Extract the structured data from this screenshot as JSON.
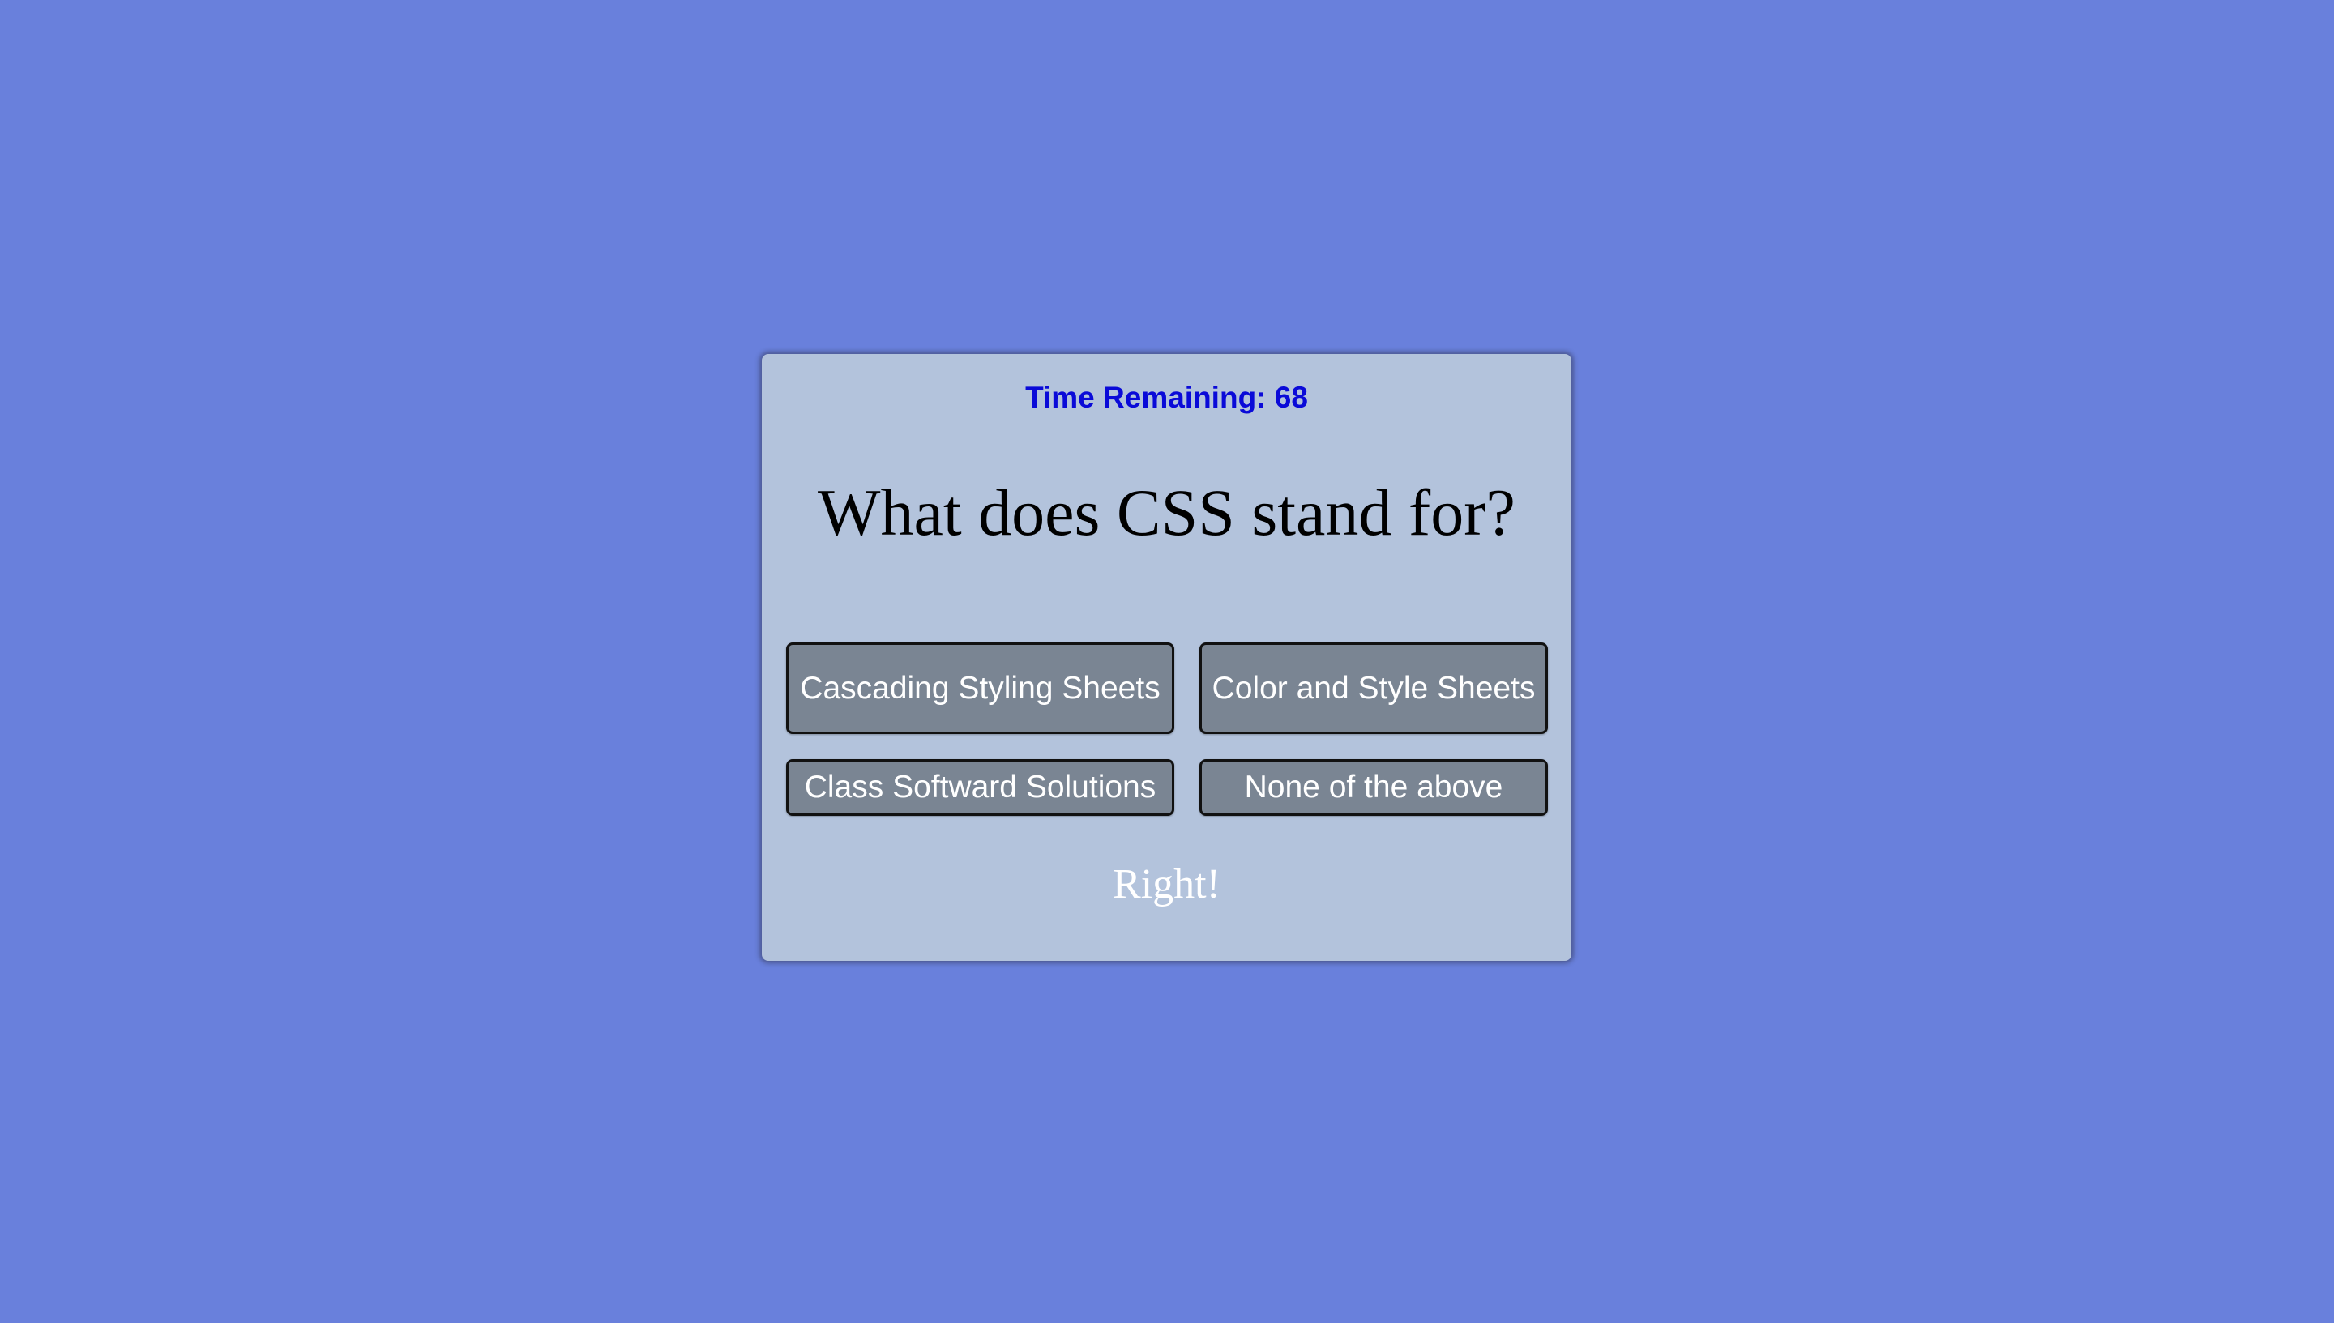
{
  "timer": {
    "label": "Time Remaining: 68"
  },
  "question": {
    "text": "What does CSS stand for?"
  },
  "answers": [
    {
      "label": "Cascading Styling Sheets"
    },
    {
      "label": "Color and Style Sheets"
    },
    {
      "label": "Class Softward Solutions"
    },
    {
      "label": "None of the above"
    }
  ],
  "feedback": {
    "text": "Right!"
  },
  "colors": {
    "background": "#6980dc",
    "card": "#b3c3dc",
    "timer_text": "#0a0ad8",
    "answer_button": "#7a8593",
    "answer_text": "#ffffff",
    "feedback_text": "#ffffff"
  }
}
